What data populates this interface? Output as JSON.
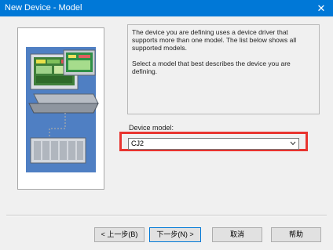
{
  "window": {
    "title": "New Device - Model",
    "close_glyph": "✕",
    "titlebar_color": "#0078d7"
  },
  "description": {
    "paragraph1": "The device you are defining uses a device driver that supports more than one model.  The list below shows all supported models.",
    "paragraph2": "Select  a model that best describes the device you are defining."
  },
  "device_model": {
    "label": "Device model:",
    "selected": "CJ2",
    "highlight_color": "#e8342f"
  },
  "buttons": {
    "back": "< 上一步(B)",
    "next": "下一步(N) >",
    "cancel": "取消",
    "help": "帮助"
  },
  "icons": {
    "illustration": "computer-with-plc-illustration",
    "close": "close-icon",
    "dropdown": "chevron-down-icon"
  }
}
